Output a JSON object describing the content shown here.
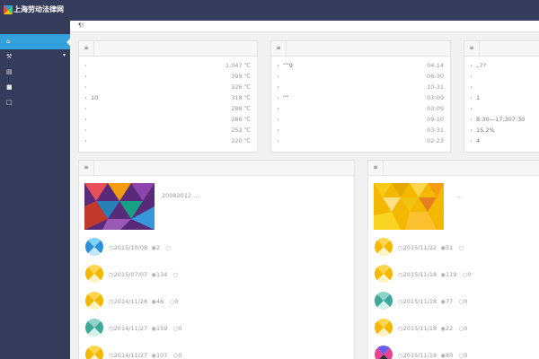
{
  "app": {
    "title": "上海劳动法律网"
  },
  "breadcrumb": {
    "text": "¶!"
  },
  "sidebar": {
    "items": [
      {
        "icon": "home-icon",
        "glyph": "⌂",
        "active": true
      },
      {
        "icon": "wrench-icon",
        "glyph": "⚒",
        "caret": "▾"
      },
      {
        "icon": "books-icon",
        "glyph": "▤"
      },
      {
        "icon": "document-icon",
        "glyph": "■"
      },
      {
        "icon": "file-icon",
        "glyph": "□"
      }
    ]
  },
  "panels": {
    "left": {
      "icon": "list-icon",
      "rows": [
        {
          "label": "",
          "value": "1,047 ℃"
        },
        {
          "label": "",
          "value": "399 ℃"
        },
        {
          "label": "",
          "value": "326 ℃"
        },
        {
          "label": "10",
          "value": "318 ℃"
        },
        {
          "label": "",
          "value": "288 ℃"
        },
        {
          "label": "",
          "value": "286 ℃"
        },
        {
          "label": "",
          "value": "252 ℃"
        },
        {
          "label": "",
          "value": "220 ℃"
        }
      ]
    },
    "middle": {
      "icon": "list-icon",
      "rows": [
        {
          "label": "“”9",
          "value": "04-14"
        },
        {
          "label": "",
          "value": "06-30"
        },
        {
          "label": "",
          "value": "10-31"
        },
        {
          "label": "“”",
          "value": "03-09"
        },
        {
          "label": "",
          "value": "03-09"
        },
        {
          "label": "",
          "value": "09-10"
        },
        {
          "label": "",
          "value": "03-31"
        },
        {
          "label": "",
          "value": "02-23"
        }
      ]
    },
    "right": {
      "icon": "list-icon",
      "rows": [
        {
          "label": ",,??",
          "value": ""
        },
        {
          "label": "",
          "value": ""
        },
        {
          "label": "",
          "value": ""
        },
        {
          "label": "1",
          "value": ""
        },
        {
          "label": "",
          "value": ""
        },
        {
          "label": "8:30—17:307:30",
          "value": ""
        },
        {
          "label": "15.2%",
          "value": ""
        },
        {
          "label": "4",
          "value": ""
        }
      ]
    }
  },
  "feeds": {
    "left": {
      "icon": "list-icon",
      "feature_text": "20082012 ...",
      "entries": [
        {
          "date": "2015/10/08",
          "views": "2",
          "comments": "",
          "avatar": "blue"
        },
        {
          "date": "2015/07/07",
          "views": "134",
          "comments": "",
          "avatar": "yellow"
        },
        {
          "date": "2014/11/28",
          "views": "46",
          "comments": "0",
          "avatar": "yellow"
        },
        {
          "date": "2014/11/27",
          "views": "159",
          "comments": "0",
          "avatar": "teal"
        },
        {
          "date": "2014/11/27",
          "views": "107",
          "comments": "0",
          "avatar": "yellow"
        }
      ]
    },
    "right": {
      "icon": "list-icon",
      "feature_text": "...",
      "entries": [
        {
          "date": "2015/11/22",
          "views": "51",
          "comments": "",
          "avatar": "yellow"
        },
        {
          "date": "2015/11/18",
          "views": "119",
          "comments": "0",
          "avatar": "yellow"
        },
        {
          "date": "2015/11/18",
          "views": "77",
          "comments": "0",
          "avatar": "teal"
        },
        {
          "date": "2015/11/18",
          "views": "22",
          "comments": "0",
          "avatar": "yellow"
        },
        {
          "date": "2015/11/18",
          "views": "80",
          "comments": "0",
          "avatar": "purple"
        }
      ]
    }
  },
  "glyphs": {
    "clock": "◷",
    "eye": "◉",
    "comment": "○",
    "chevron": "›",
    "list": "≡"
  }
}
